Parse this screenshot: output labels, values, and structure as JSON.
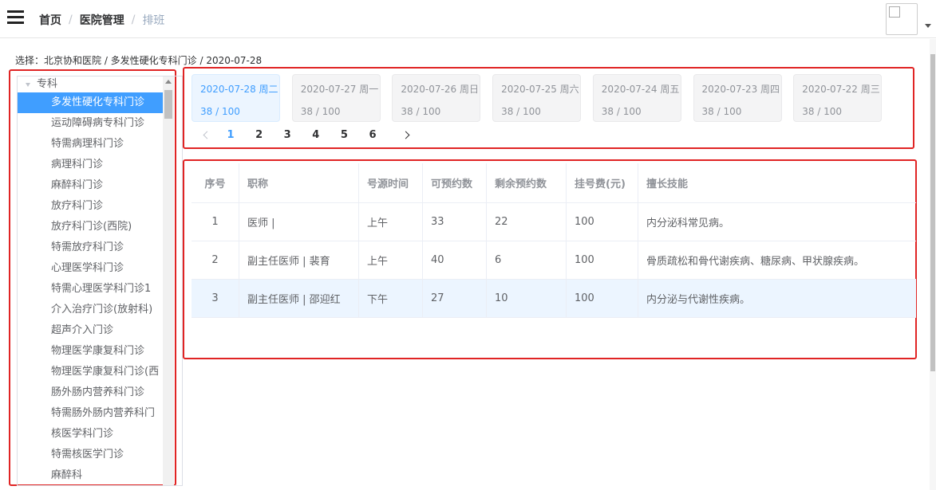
{
  "header": {
    "breadcrumb": [
      "首页",
      "医院管理",
      "排班"
    ],
    "separator": "/"
  },
  "selection": "选择：北京协和医院 / 多发性硬化专科门诊 / 2020-07-28",
  "tree": {
    "root": "专科",
    "items": [
      "多发性硬化专科门诊",
      "运动障碍病专科门诊",
      "特需病理科门诊",
      "病理科门诊",
      "麻醉科门诊",
      "放疗科门诊",
      "放疗科门诊(西院)",
      "特需放疗科门诊",
      "心理医学科门诊",
      "特需心理医学科门诊1",
      "介入治疗门诊(放射科)",
      "超声介入门诊",
      "物理医学康复科门诊",
      "物理医学康复科门诊(西",
      "肠外肠内营养科门诊",
      "特需肠外肠内营养科门",
      "核医学科门诊",
      "特需核医学门诊",
      "麻醉科"
    ],
    "active_index": 0
  },
  "dates": [
    {
      "date": "2020-07-28 周二",
      "count": "38 / 100",
      "active": true
    },
    {
      "date": "2020-07-27 周一",
      "count": "38 / 100",
      "active": false
    },
    {
      "date": "2020-07-26 周日",
      "count": "38 / 100",
      "active": false
    },
    {
      "date": "2020-07-25 周六",
      "count": "38 / 100",
      "active": false
    },
    {
      "date": "2020-07-24 周五",
      "count": "38 / 100",
      "active": false
    },
    {
      "date": "2020-07-23 周四",
      "count": "38 / 100",
      "active": false
    },
    {
      "date": "2020-07-22 周三",
      "count": "38 / 100",
      "active": false
    }
  ],
  "pagination": {
    "pages": [
      "1",
      "2",
      "3",
      "4",
      "5",
      "6"
    ],
    "current": "1"
  },
  "table": {
    "headers": [
      "序号",
      "职称",
      "号源时间",
      "可预约数",
      "剩余预约数",
      "挂号费(元)",
      "擅长技能"
    ],
    "rows": [
      [
        "1",
        "医师 |",
        "上午",
        "33",
        "22",
        "100",
        "内分泌科常见病。"
      ],
      [
        "2",
        "副主任医师 | 裴育",
        "上午",
        "40",
        "6",
        "100",
        "骨质疏松和骨代谢疾病、糖尿病、甲状腺疾病。"
      ],
      [
        "3",
        "副主任医师 | 邵迎红",
        "下午",
        "27",
        "10",
        "100",
        "内分泌与代谢性疾病。"
      ]
    ],
    "highlighted_row": 2
  }
}
